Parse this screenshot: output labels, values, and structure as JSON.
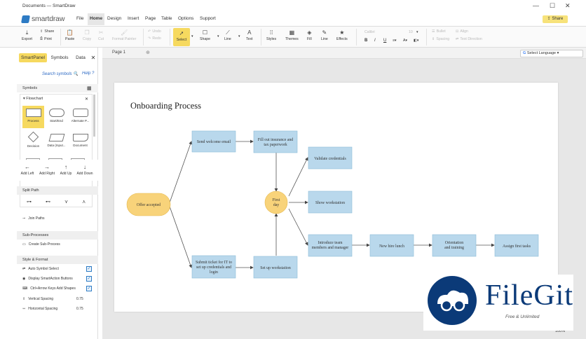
{
  "window": {
    "title": "Documents — SmartDraw",
    "minimize": "—",
    "maximize": "☐",
    "close": "✕"
  },
  "menubar": {
    "logo": "smartdraw",
    "items": [
      "File",
      "Home",
      "Design",
      "Insert",
      "Page",
      "Table",
      "Options",
      "Support"
    ],
    "active": "Home",
    "share": "Share"
  },
  "ribbon": {
    "export": "Export",
    "share": "Share",
    "print": "Print",
    "paste": "Paste",
    "copy": "Copy",
    "cut": "Cut",
    "format_painter": "Format Painter",
    "undo": "Undo",
    "redo": "Redo",
    "select": "Select",
    "shape": "Shape",
    "line": "Line",
    "text": "Text",
    "styles": "Styles",
    "themes": "Themes",
    "fill": "Fill",
    "line2": "Line",
    "effects": "Effects",
    "font": "Calibri",
    "font_size": "10",
    "bold": "B",
    "italic": "I",
    "underline": "U",
    "bullet": "Bullet",
    "align": "Align",
    "spacing": "Spacing",
    "text_direction": "Text Direction"
  },
  "leftpanel": {
    "tabs": [
      "SmartPanel",
      "Symbols",
      "Data"
    ],
    "close": "✕",
    "search": "Search symbols",
    "help": "Help",
    "symbols_header": "Symbols",
    "library": "Flowchart",
    "shapes": [
      "Process",
      "Start/End",
      "Alternate P...",
      "Decision",
      "Data (Input...",
      "Document"
    ],
    "add": [
      "Add Left",
      "Add Right",
      "Add Up",
      "Add Down"
    ],
    "split_path": "Split Path",
    "join_paths": "Join Paths",
    "sub_processes": "Sub-Processes",
    "create_sub": "Create Sub-Process",
    "style_format": "Style & Format",
    "auto_symbol": "Auto Symbol Select",
    "smartaction": "Display SmartAction Buttons",
    "ctrl_arrow": "Ctrl+Arrow Keys Add Shapes",
    "vertical_spacing": "Vertical Spacing",
    "vertical_value": "0.75",
    "horizontal_spacing": "Horizontal Spacing",
    "horizontal_value": "0.75"
  },
  "canvas": {
    "page_tab": "Page 1",
    "language": "Select Language",
    "zoom": "100%"
  },
  "diagram": {
    "title": "Onboarding Process",
    "nodes": {
      "offer": "Offer accepted",
      "welcome": "Send welcome email",
      "insurance": [
        "Fill out insurance and",
        "tax paperwork"
      ],
      "ticket": [
        "Submit ticket for IT to",
        "set up credentials and",
        "login"
      ],
      "workstation": "Set up workstation",
      "firstday": [
        "First",
        "day"
      ],
      "validate": "Validate credentials",
      "show": "Show workstation",
      "introduce": [
        "Introduce team",
        "members and manager"
      ],
      "lunch": "New hire lunch",
      "orientation": [
        "Orientation",
        "and training"
      ],
      "assign": "Assign first tasks"
    },
    "colors": {
      "process": "#b9d8ec",
      "start": "#f8d37a",
      "border": "#8cbcd8"
    }
  },
  "watermark": {
    "word": "FileGit",
    "tagline": "Free & Unlimited"
  }
}
